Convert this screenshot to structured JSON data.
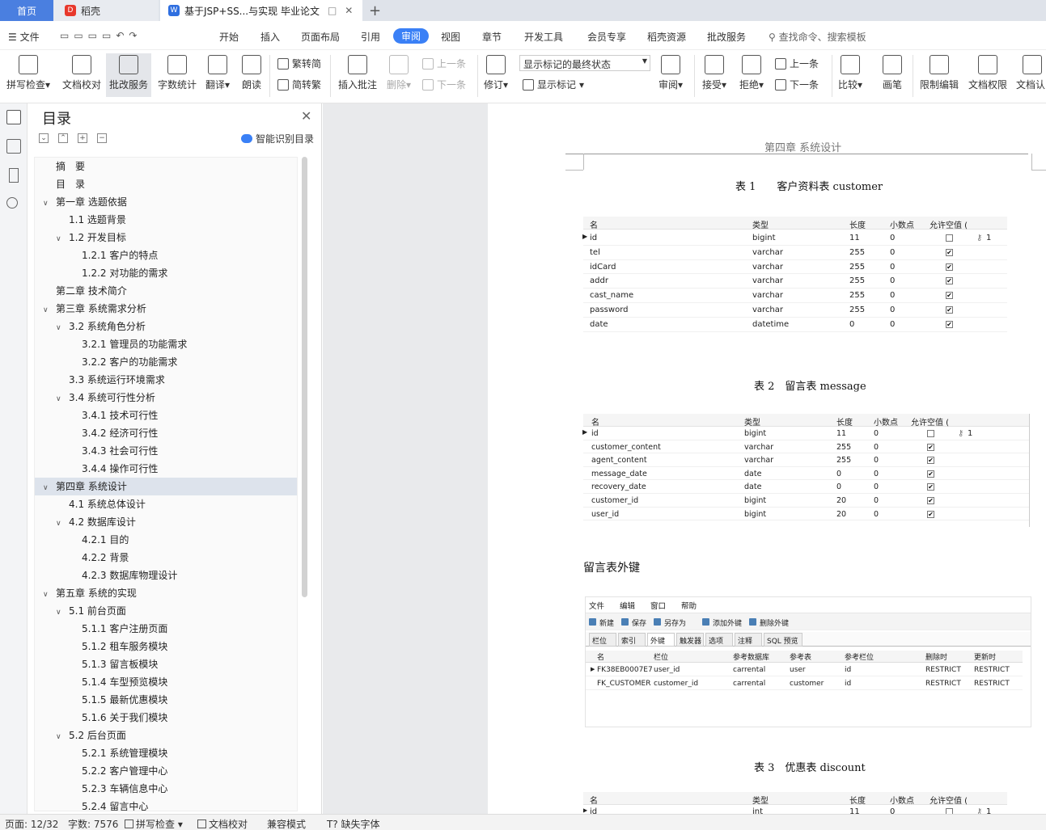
{
  "tabs": {
    "home": "首页",
    "docer": "稻壳",
    "doc": "基于JSP+SS...与实现 毕业论文"
  },
  "menu": {
    "file": "文件",
    "items": [
      "开始",
      "插入",
      "页面布局",
      "引用",
      "审阅",
      "视图",
      "章节",
      "开发工具",
      "会员专享",
      "稻壳资源",
      "批改服务"
    ],
    "search": "查找命令、搜索模板"
  },
  "ribbon": {
    "spell": "拼写检查",
    "proofread": "文档校对",
    "correct_service": "批改服务",
    "word_count": "字数统计",
    "translate": "翻译",
    "read_aloud": "朗读",
    "trad": "繁转简",
    "simp": "简转繁",
    "insert_comment": "插入批注",
    "delete": "删除",
    "prev": "上一条",
    "next": "下一条",
    "revise": "修订",
    "markup_state": "显示标记的最终状态",
    "show_markup": "显示标记",
    "review": "审阅",
    "accept": "接受",
    "reject": "拒绝",
    "prev2": "上一条",
    "next2": "下一条",
    "compare": "比较",
    "pen": "画笔",
    "restrict": "限制编辑",
    "doc_rights": "文档权限",
    "doc_cert": "文档认"
  },
  "toc": {
    "title": "目录",
    "smart": "智能识别目录",
    "items": [
      {
        "t": "摘　要",
        "l": 0,
        "c": ""
      },
      {
        "t": "目　录",
        "l": 0,
        "c": ""
      },
      {
        "t": "第一章 选题依据",
        "l": 0,
        "c": "v"
      },
      {
        "t": "1.1 选题背景",
        "l": 1,
        "c": ""
      },
      {
        "t": "1.2 开发目标",
        "l": 1,
        "c": "v"
      },
      {
        "t": "1.2.1 客户的特点",
        "l": 2,
        "c": ""
      },
      {
        "t": "1.2.2 对功能的需求",
        "l": 2,
        "c": ""
      },
      {
        "t": "第二章  技术简介",
        "l": 0,
        "c": ""
      },
      {
        "t": "第三章  系统需求分析",
        "l": 0,
        "c": "v"
      },
      {
        "t": "3.2  系统角色分析",
        "l": 1,
        "c": "v"
      },
      {
        "t": "3.2.1  管理员的功能需求",
        "l": 2,
        "c": ""
      },
      {
        "t": "3.2.2  客户的功能需求",
        "l": 2,
        "c": ""
      },
      {
        "t": "3.3  系统运行环境需求",
        "l": 1,
        "c": ""
      },
      {
        "t": "3.4  系统可行性分析",
        "l": 1,
        "c": "v"
      },
      {
        "t": "3.4.1  技术可行性",
        "l": 2,
        "c": ""
      },
      {
        "t": "3.4.2  经济可行性",
        "l": 2,
        "c": ""
      },
      {
        "t": "3.4.3  社会可行性",
        "l": 2,
        "c": ""
      },
      {
        "t": "3.4.4  操作可行性",
        "l": 2,
        "c": ""
      },
      {
        "t": "第四章  系统设计",
        "l": 0,
        "c": "v",
        "sel": true
      },
      {
        "t": "4.1  系统总体设计",
        "l": 1,
        "c": ""
      },
      {
        "t": "4.2  数据库设计",
        "l": 1,
        "c": "v"
      },
      {
        "t": "4.2.1  目的",
        "l": 2,
        "c": ""
      },
      {
        "t": "4.2.2  背景",
        "l": 2,
        "c": ""
      },
      {
        "t": "4.2.3  数据库物理设计",
        "l": 2,
        "c": ""
      },
      {
        "t": "第五章  系统的实现",
        "l": 0,
        "c": "v"
      },
      {
        "t": "5.1 前台页面",
        "l": 1,
        "c": "v"
      },
      {
        "t": "5.1.1 客户注册页面",
        "l": 2,
        "c": ""
      },
      {
        "t": "5.1.2 租车服务模块",
        "l": 2,
        "c": ""
      },
      {
        "t": "5.1.3 留言板模块",
        "l": 2,
        "c": ""
      },
      {
        "t": "5.1.4 车型预览模块",
        "l": 2,
        "c": ""
      },
      {
        "t": "5.1.5 最新优惠模块",
        "l": 2,
        "c": ""
      },
      {
        "t": "5.1.6 关于我们模块",
        "l": 2,
        "c": ""
      },
      {
        "t": "5.2  后台页面",
        "l": 1,
        "c": "v"
      },
      {
        "t": "5.2.1 系统管理模块",
        "l": 2,
        "c": ""
      },
      {
        "t": "5.2.2 客户管理中心",
        "l": 2,
        "c": ""
      },
      {
        "t": "5.2.3 车辆信息中心",
        "l": 2,
        "c": ""
      },
      {
        "t": "5.2.4 留言中心",
        "l": 2,
        "c": ""
      }
    ]
  },
  "doc": {
    "header": "第四章  系统设计",
    "cap1": "表 1　　客户资料表 customer",
    "cap2": "表 2　留言表 message",
    "fk_title": "留言表外键",
    "cap3": "表 3　优惠表 discount",
    "cols": [
      "名",
      "类型",
      "长度",
      "小数点",
      "允许空值 ("
    ],
    "t1": [
      [
        "id",
        "bigint",
        "11",
        "0",
        false,
        "1"
      ],
      [
        "tel",
        "varchar",
        "255",
        "0",
        true,
        ""
      ],
      [
        "idCard",
        "varchar",
        "255",
        "0",
        true,
        ""
      ],
      [
        "addr",
        "varchar",
        "255",
        "0",
        true,
        ""
      ],
      [
        "cast_name",
        "varchar",
        "255",
        "0",
        true,
        ""
      ],
      [
        "password",
        "varchar",
        "255",
        "0",
        true,
        ""
      ],
      [
        "date",
        "datetime",
        "0",
        "0",
        true,
        ""
      ]
    ],
    "t2": [
      [
        "id",
        "bigint",
        "11",
        "0",
        false,
        "1"
      ],
      [
        "customer_content",
        "varchar",
        "255",
        "0",
        true,
        ""
      ],
      [
        "agent_content",
        "varchar",
        "255",
        "0",
        true,
        ""
      ],
      [
        "message_date",
        "date",
        "0",
        "0",
        true,
        ""
      ],
      [
        "recovery_date",
        "date",
        "0",
        "0",
        true,
        ""
      ],
      [
        "customer_id",
        "bigint",
        "20",
        "0",
        true,
        ""
      ],
      [
        "user_id",
        "bigint",
        "20",
        "0",
        true,
        ""
      ]
    ],
    "fk": {
      "menu": [
        "文件",
        "编辑",
        "窗口",
        "帮助"
      ],
      "tools": [
        "新建",
        "保存",
        "另存为",
        "添加外键",
        "删除外键"
      ],
      "tabs": [
        "栏位",
        "索引",
        "外键",
        "触发器",
        "选项",
        "注释",
        "SQL 预览"
      ],
      "cols": [
        "名",
        "栏位",
        "参考数据库",
        "参考表",
        "参考栏位",
        "删除时",
        "更新时"
      ],
      "rows": [
        [
          "FK38EB0007E7",
          "user_id",
          "carrental",
          "user",
          "id",
          "RESTRICT",
          "RESTRICT"
        ],
        [
          "FK_CUSTOMER",
          "customer_id",
          "carrental",
          "customer",
          "id",
          "RESTRICT",
          "RESTRICT"
        ]
      ]
    },
    "t3": [
      [
        "id",
        "int",
        "11",
        "0",
        false,
        "1"
      ]
    ]
  },
  "status": {
    "page": "页面: 12/32",
    "words": "字数: 7576",
    "spell": "拼写检查",
    "proof": "文档校对",
    "compat": "兼容模式",
    "font": "缺失字体"
  }
}
